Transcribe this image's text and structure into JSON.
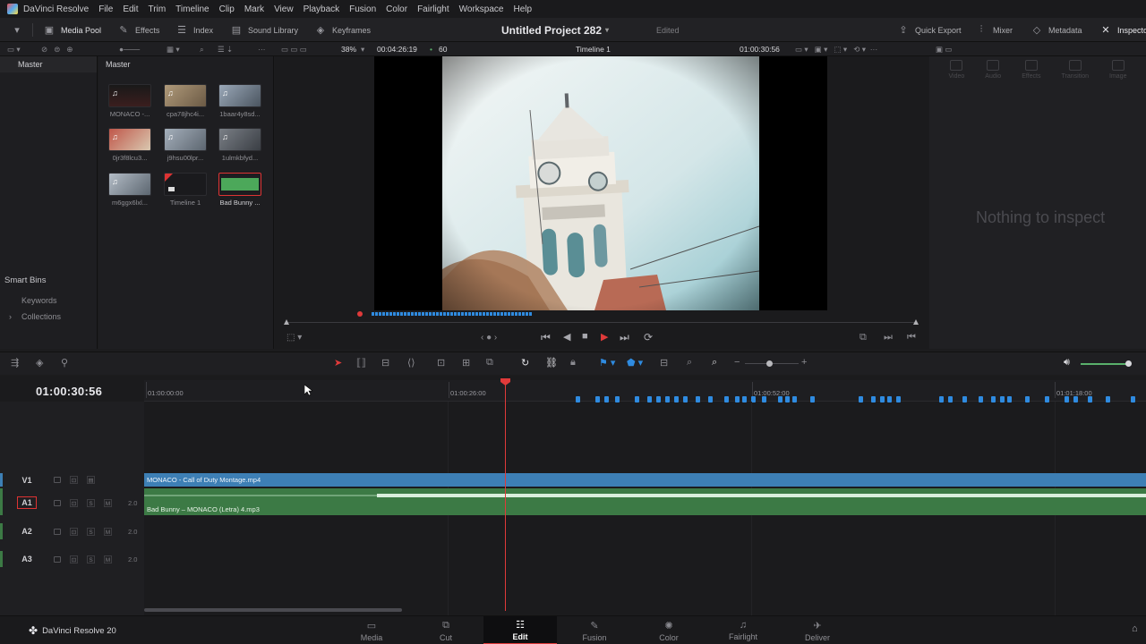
{
  "menu": {
    "items": [
      "DaVinci Resolve",
      "File",
      "Edit",
      "Trim",
      "Timeline",
      "Clip",
      "Mark",
      "View",
      "Playback",
      "Fusion",
      "Color",
      "Fairlight",
      "Workspace",
      "Help"
    ]
  },
  "toolbar": {
    "media_pool": "Media Pool",
    "effects": "Effects",
    "index": "Index",
    "sound_library": "Sound Library",
    "keyframes": "Keyframes",
    "project_title": "Untitled Project 282",
    "edited": "Edited",
    "quick_export": "Quick Export",
    "mixer": "Mixer",
    "metadata": "Metadata",
    "inspector": "Inspector"
  },
  "viewer_bar": {
    "zoom": "38%",
    "source_tc": "00:04:26:19",
    "fps": "60",
    "timeline_name": "Timeline 1",
    "record_tc": "01:00:30:56"
  },
  "bins": {
    "header": "Master",
    "smart_bins": "Smart Bins",
    "keywords": "Keywords",
    "collections": "Collections"
  },
  "pool": {
    "header": "Master",
    "clips": [
      {
        "name": "MONACO -...",
        "color": "#2a2a2e"
      },
      {
        "name": "cpa78jhc4i...",
        "color": "#8a7a62"
      },
      {
        "name": "1baar4y8sd...",
        "color": "#6d7a88"
      },
      {
        "name": "0jr3f8lcu3...",
        "color": "#a05040"
      },
      {
        "name": "j9hsu00lpr...",
        "color": "#7f8790"
      },
      {
        "name": "1ulmkbfyd...",
        "color": "#595f66"
      },
      {
        "name": "m6ggx6lxl...",
        "color": "#7c8590"
      },
      {
        "name": "Timeline 1",
        "color": "#202024"
      },
      {
        "name": "Bad Bunny ...",
        "color": "#4ca85a"
      }
    ]
  },
  "inspector": {
    "tabs": [
      "Video",
      "Audio",
      "Effects",
      "Transition",
      "Image"
    ],
    "empty": "Nothing to inspect"
  },
  "timeline": {
    "timecode": "01:00:30:56",
    "ruler": [
      "01:00:00:00",
      "01:00:26:00",
      "01:00:52:00",
      "01:01:18:00"
    ],
    "tracks": [
      {
        "name": "V1",
        "level": ""
      },
      {
        "name": "A1",
        "level": "2.0"
      },
      {
        "name": "A2",
        "level": "2.0"
      },
      {
        "name": "A3",
        "level": "2.0"
      }
    ],
    "video_clip": "MONACO - Call of Duty Montage.mp4",
    "audio_clip": "Bad Bunny – MONACO (Letra) 4.mp3"
  },
  "pages": [
    "Media",
    "Cut",
    "Edit",
    "Fusion",
    "Color",
    "Fairlight",
    "Deliver"
  ],
  "active_page": "Edit",
  "brand": "DaVinci Resolve 20",
  "colors": {
    "accent_red": "#e03a3a",
    "video_clip": "#3d7fb5",
    "audio_clip": "#3c7a45",
    "marker_blue": "#2f8be0"
  }
}
